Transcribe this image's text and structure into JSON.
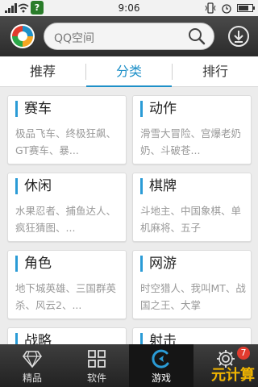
{
  "status": {
    "time": "9:06"
  },
  "header": {
    "search_placeholder": "QQ空间"
  },
  "tabs": [
    {
      "label": "推荐",
      "active": false
    },
    {
      "label": "分类",
      "active": true
    },
    {
      "label": "排行",
      "active": false
    }
  ],
  "categories": [
    {
      "title": "赛车",
      "desc": "极品飞车、终极狂飙、GT赛车、暴..."
    },
    {
      "title": "动作",
      "desc": "滑雪大冒险、宫爆老奶奶、斗破苍..."
    },
    {
      "title": "休闲",
      "desc": "水果忍者、捕鱼达人、疯狂猜图、..."
    },
    {
      "title": "棋牌",
      "desc": "斗地主、中国象棋、单机麻将、五子"
    },
    {
      "title": "角色",
      "desc": "地下城英雄、三国群英杀、风云2、..."
    },
    {
      "title": "网游",
      "desc": "时空猎人、我叫MT、战国之王、大掌"
    },
    {
      "title": "战略",
      "desc": ""
    },
    {
      "title": "射击",
      "desc": ""
    }
  ],
  "bottom_nav": [
    {
      "label": "精品",
      "active": false,
      "icon": "diamond-icon"
    },
    {
      "label": "软件",
      "active": false,
      "icon": "grid-icon"
    },
    {
      "label": "游戏",
      "active": true,
      "icon": "game-icon"
    },
    {
      "label": "",
      "active": false,
      "icon": "gear-icon",
      "badge": "7"
    }
  ],
  "watermark": "元计算",
  "colors": {
    "accent": "#1e90c8",
    "header": "#2b2b2b",
    "badge": "#e23b2e"
  }
}
